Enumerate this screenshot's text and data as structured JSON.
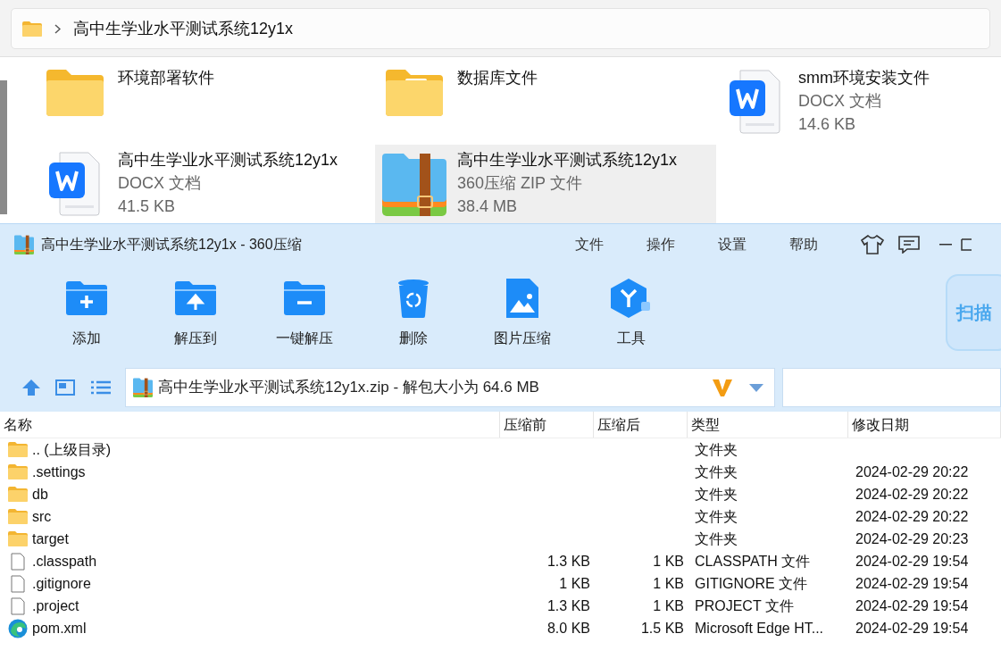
{
  "explorer": {
    "breadcrumb": "高中生学业水平测试系统12y1x",
    "items": [
      {
        "kind": "folder",
        "name": "环境部署软件",
        "selected": false
      },
      {
        "kind": "folder-doc",
        "name": "数据库文件",
        "selected": false
      },
      {
        "kind": "docx",
        "name": "smm环境安装文件",
        "type": "DOCX 文档",
        "size": "14.6 KB",
        "selected": false
      },
      {
        "kind": "docx",
        "name": "高中生学业水平测试系统12y1x",
        "type": "DOCX 文档",
        "size": "41.5 KB",
        "selected": false
      },
      {
        "kind": "zip",
        "name": "高中生学业水平测试系统12y1x",
        "type": "360压缩 ZIP 文件",
        "size": "38.4 MB",
        "selected": true
      }
    ]
  },
  "archiver": {
    "title": "高中生学业水平测试系统12y1x - 360压缩",
    "menu": [
      "文件",
      "操作",
      "设置",
      "帮助"
    ],
    "tools": [
      {
        "kind": "add",
        "label": "添加"
      },
      {
        "kind": "extract-to",
        "label": "解压到"
      },
      {
        "kind": "extract",
        "label": "一键解压"
      },
      {
        "kind": "delete",
        "label": "删除"
      },
      {
        "kind": "image",
        "label": "图片压缩"
      },
      {
        "kind": "tools",
        "label": "工具"
      }
    ],
    "scan_label": "扫描",
    "path": "高中生学业水平测试系统12y1x.zip - 解包大小为 64.6 MB",
    "table": {
      "columns": [
        "名称",
        "压缩前",
        "压缩后",
        "类型",
        "修改日期"
      ],
      "rows": [
        {
          "kind": "folder",
          "name": ".. (上级目录)",
          "before": "",
          "after": "",
          "type": "文件夹",
          "date": ""
        },
        {
          "kind": "folder",
          "name": ".settings",
          "before": "",
          "after": "",
          "type": "文件夹",
          "date": "2024-02-29 20:22"
        },
        {
          "kind": "folder",
          "name": "db",
          "before": "",
          "after": "",
          "type": "文件夹",
          "date": "2024-02-29 20:22"
        },
        {
          "kind": "folder",
          "name": "src",
          "before": "",
          "after": "",
          "type": "文件夹",
          "date": "2024-02-29 20:22"
        },
        {
          "kind": "folder",
          "name": "target",
          "before": "",
          "after": "",
          "type": "文件夹",
          "date": "2024-02-29 20:23"
        },
        {
          "kind": "file",
          "name": ".classpath",
          "before": "1.3 KB",
          "after": "1 KB",
          "type": "CLASSPATH 文件",
          "date": "2024-02-29 19:54"
        },
        {
          "kind": "file",
          "name": ".gitignore",
          "before": "1 KB",
          "after": "1 KB",
          "type": "GITIGNORE 文件",
          "date": "2024-02-29 19:54"
        },
        {
          "kind": "file",
          "name": ".project",
          "before": "1.3 KB",
          "after": "1 KB",
          "type": "PROJECT 文件",
          "date": "2024-02-29 19:54"
        },
        {
          "kind": "edge",
          "name": "pom.xml",
          "before": "8.0 KB",
          "after": "1.5 KB",
          "type": "Microsoft Edge HT...",
          "date": "2024-02-29 19:54"
        }
      ]
    }
  }
}
